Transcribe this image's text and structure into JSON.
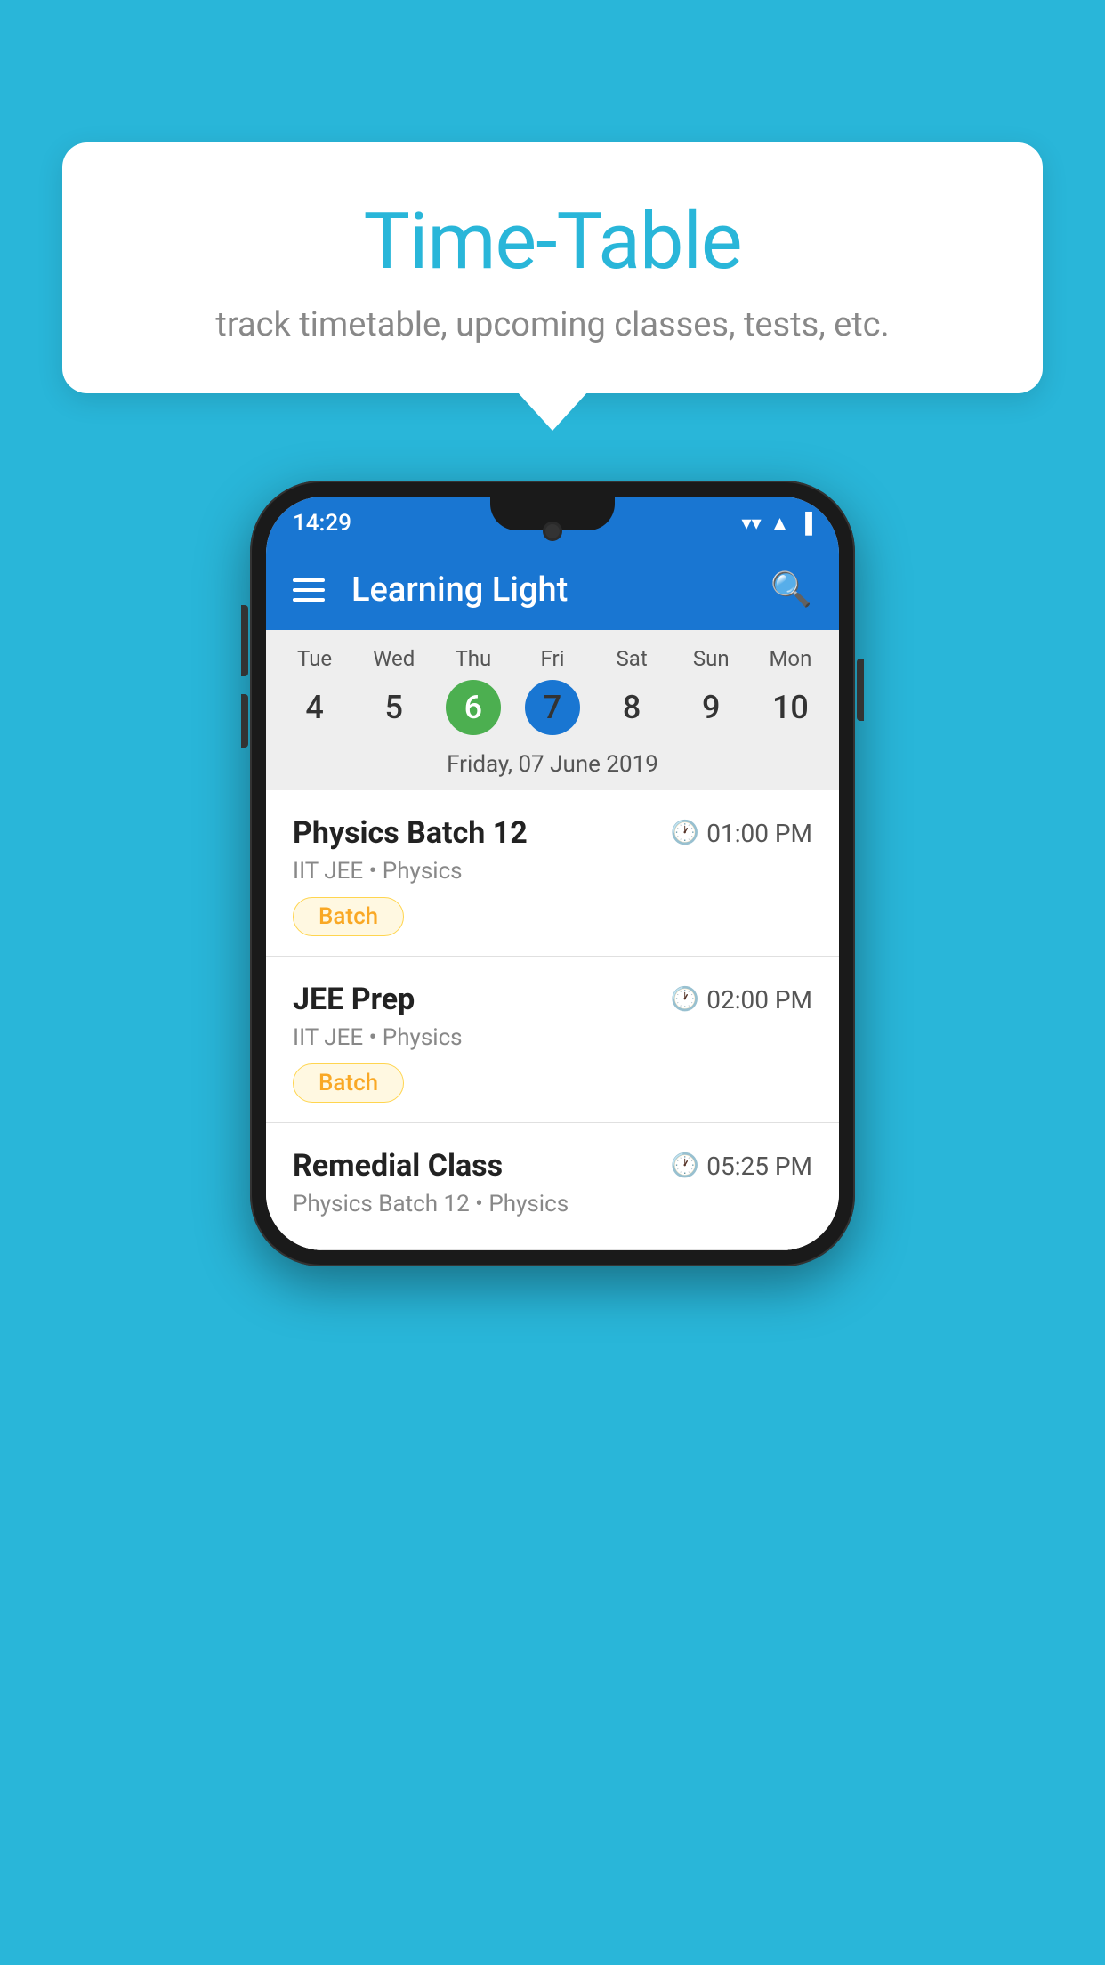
{
  "page": {
    "background_color": "#29B6D9"
  },
  "tooltip": {
    "title": "Time-Table",
    "subtitle": "track timetable, upcoming classes, tests, etc."
  },
  "phone": {
    "status_bar": {
      "time": "14:29"
    },
    "app_bar": {
      "title": "Learning Light"
    },
    "calendar": {
      "days": [
        {
          "label": "Tue",
          "num": "4"
        },
        {
          "label": "Wed",
          "num": "5"
        },
        {
          "label": "Thu",
          "num": "6",
          "state": "today"
        },
        {
          "label": "Fri",
          "num": "7",
          "state": "selected"
        },
        {
          "label": "Sat",
          "num": "8"
        },
        {
          "label": "Sun",
          "num": "9"
        },
        {
          "label": "Mon",
          "num": "10"
        }
      ],
      "selected_date": "Friday, 07 June 2019"
    },
    "classes": [
      {
        "name": "Physics Batch 12",
        "time": "01:00 PM",
        "meta": "IIT JEE • Physics",
        "badge": "Batch"
      },
      {
        "name": "JEE Prep",
        "time": "02:00 PM",
        "meta": "IIT JEE • Physics",
        "badge": "Batch"
      },
      {
        "name": "Remedial Class",
        "time": "05:25 PM",
        "meta": "Physics Batch 12 • Physics",
        "badge": null
      }
    ]
  }
}
